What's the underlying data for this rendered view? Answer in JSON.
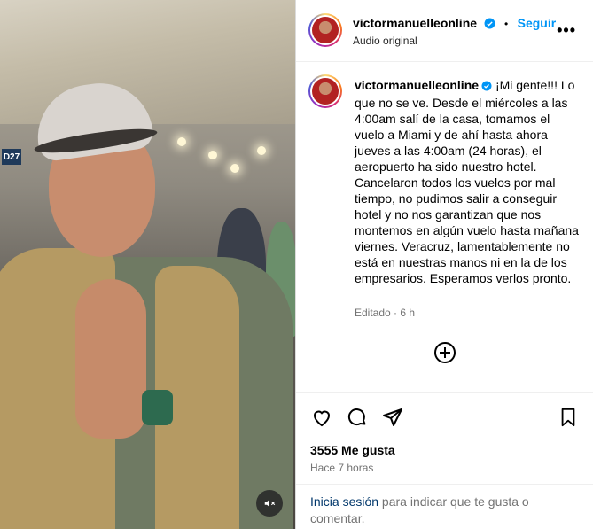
{
  "post": {
    "username": "victormanuelleonline",
    "follow_label": "Seguir",
    "audio_label": "Audio original",
    "more_label": "•••",
    "caption_text": "¡Mi gente!!! Lo que no se ve. Desde el miércoles a las 4:00am salí de la casa, tomamos el vuelo a Miami y de ahí hasta ahora jueves a las 4:00am (24 horas), el aeropuerto ha sido nuestro hotel. Cancelaron todos los vuelos por mal tiempo, no pudimos salir a conseguir hotel y no nos garantizan que nos montemos en algún vuelo hasta mañana viernes. Veracruz, lamentablemente no está en nuestras manos ni en la de los empresarios. Esperamos verlos pronto.",
    "edited_label": "Editado · 6 h",
    "likes_label": "3555 Me gusta",
    "time_label": "Hace 7 horas",
    "login_link": "Inicia sesión",
    "login_rest": " para indicar que te gusta o comentar."
  },
  "media": {
    "gate_sign": "D27",
    "mute_icon": "muted-speaker-icon"
  },
  "icons": {
    "verified": "verified-badge-icon",
    "like": "heart-icon",
    "comment": "comment-bubble-icon",
    "share": "paper-plane-icon",
    "save": "bookmark-icon",
    "load_more": "plus-circle-icon"
  },
  "colors": {
    "link": "#0095f6",
    "verified": "#0095f6",
    "muted_text": "#737373"
  }
}
